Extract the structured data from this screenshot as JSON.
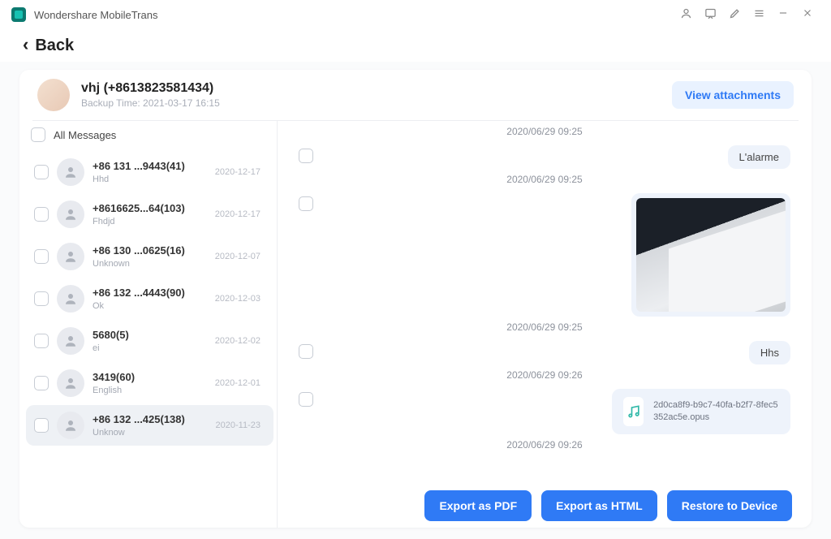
{
  "app": {
    "title": "Wondershare MobileTrans"
  },
  "back": {
    "label": "Back"
  },
  "header": {
    "title": "vhj (+8613823581434)",
    "subtitle": "Backup Time: 2021-03-17 16:15",
    "view_attachments": "View attachments"
  },
  "sidebar": {
    "all_label": "All Messages",
    "contacts": [
      {
        "name": "+86 131 ...9443(41)",
        "preview": "Hhd",
        "date": "2020-12-17",
        "selected": false
      },
      {
        "name": "+8616625...64(103)",
        "preview": "Fhdjd",
        "date": "2020-12-17",
        "selected": false
      },
      {
        "name": "+86 130 ...0625(16)",
        "preview": "Unknown",
        "date": "2020-12-07",
        "selected": false
      },
      {
        "name": "+86 132 ...4443(90)",
        "preview": "Ok",
        "date": "2020-12-03",
        "selected": false
      },
      {
        "name": "5680(5)",
        "preview": "ei",
        "date": "2020-12-02",
        "selected": false
      },
      {
        "name": "3419(60)",
        "preview": "English",
        "date": "2020-12-01",
        "selected": false
      },
      {
        "name": "+86 132 ...425(138)",
        "preview": "Unknow",
        "date": "2020-11-23",
        "selected": true
      }
    ]
  },
  "messages": [
    {
      "type": "timestamp",
      "text": "2020/06/29 09:25"
    },
    {
      "type": "text",
      "text": "L'alarme"
    },
    {
      "type": "timestamp",
      "text": "2020/06/29 09:25"
    },
    {
      "type": "image"
    },
    {
      "type": "timestamp",
      "text": "2020/06/29 09:25"
    },
    {
      "type": "text",
      "text": "Hhs"
    },
    {
      "type": "timestamp",
      "text": "2020/06/29 09:26"
    },
    {
      "type": "file",
      "filename": "2d0ca8f9-b9c7-40fa-b2f7-8fec5352ac5e.opus"
    },
    {
      "type": "timestamp",
      "text": "2020/06/29 09:26"
    }
  ],
  "footer": {
    "export_pdf": "Export as PDF",
    "export_html": "Export as HTML",
    "restore": "Restore to Device"
  }
}
